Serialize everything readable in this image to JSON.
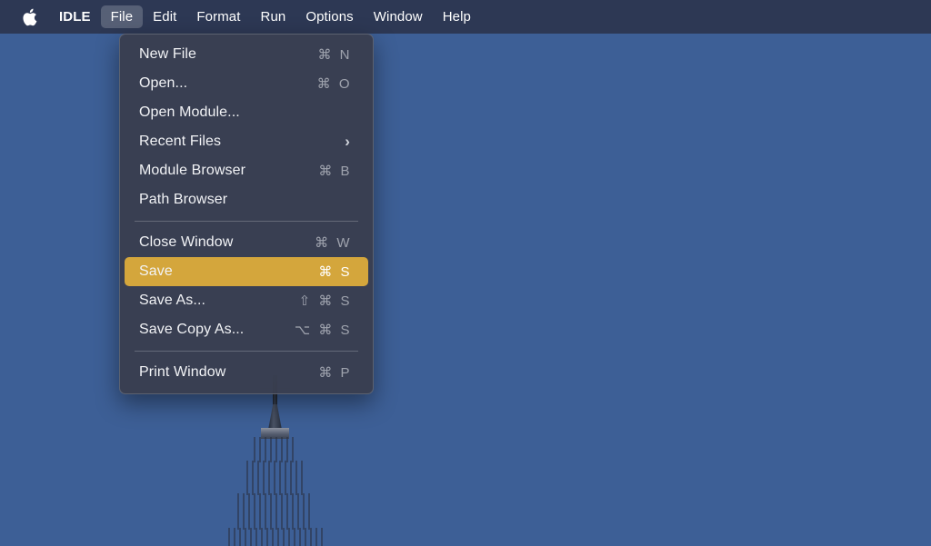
{
  "menubar": {
    "apple_icon": "apple-logo-icon",
    "app_name": "IDLE",
    "items": [
      {
        "label": "File",
        "active": true
      },
      {
        "label": "Edit",
        "active": false
      },
      {
        "label": "Format",
        "active": false
      },
      {
        "label": "Run",
        "active": false
      },
      {
        "label": "Options",
        "active": false
      },
      {
        "label": "Window",
        "active": false
      },
      {
        "label": "Help",
        "active": false
      }
    ]
  },
  "file_menu": {
    "highlight_color": "#d4a63c",
    "groups": [
      {
        "items": [
          {
            "label": "New File",
            "shortcut": "⌘ N",
            "submenu": false,
            "highlighted": false
          },
          {
            "label": "Open...",
            "shortcut": "⌘ O",
            "submenu": false,
            "highlighted": false
          },
          {
            "label": "Open Module...",
            "shortcut": "",
            "submenu": false,
            "highlighted": false
          },
          {
            "label": "Recent Files",
            "shortcut": "",
            "submenu": true,
            "highlighted": false
          },
          {
            "label": "Module Browser",
            "shortcut": "⌘ B",
            "submenu": false,
            "highlighted": false
          },
          {
            "label": "Path Browser",
            "shortcut": "",
            "submenu": false,
            "highlighted": false
          }
        ]
      },
      {
        "items": [
          {
            "label": "Close Window",
            "shortcut": "⌘ W",
            "submenu": false,
            "highlighted": false
          },
          {
            "label": "Save",
            "shortcut": "⌘ S",
            "submenu": false,
            "highlighted": true
          },
          {
            "label": "Save As...",
            "shortcut": "⇧ ⌘ S",
            "submenu": false,
            "highlighted": false
          },
          {
            "label": "Save Copy As...",
            "shortcut": "⌥ ⌘ S",
            "submenu": false,
            "highlighted": false
          }
        ]
      },
      {
        "items": [
          {
            "label": "Print Window",
            "shortcut": "⌘ P",
            "submenu": false,
            "highlighted": false
          }
        ]
      }
    ]
  },
  "desktop": {
    "wallpaper_description": "Empire State Building against blue sky with clouds",
    "sky_color": "#3d5f96",
    "cloud_color": "#d8dee8"
  }
}
